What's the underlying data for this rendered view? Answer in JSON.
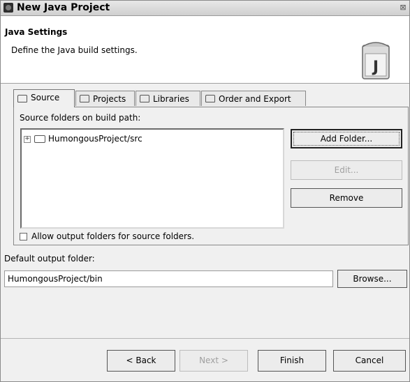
{
  "window": {
    "title": "New Java Project",
    "close_glyph": "⊠"
  },
  "banner": {
    "heading": "Java Settings",
    "description": "Define the Java build settings.",
    "icon_letter": "J"
  },
  "tabs": [
    {
      "label": "Source",
      "active": true,
      "icon": "source-folder-icon"
    },
    {
      "label": "Projects",
      "active": false,
      "icon": "projects-icon"
    },
    {
      "label": "Libraries",
      "active": false,
      "icon": "libraries-icon"
    },
    {
      "label": "Order and Export",
      "active": false,
      "icon": "order-export-icon"
    }
  ],
  "source_tab": {
    "folders_label": "Source folders on build path:",
    "tree_items": [
      {
        "label": "HumongousProject/src",
        "expander": "+"
      }
    ],
    "buttons": {
      "add_folder": "Add Folder...",
      "edit": "Edit...",
      "remove": "Remove"
    },
    "allow_output_label": "Allow output folders for source folders.",
    "allow_output_checked": false
  },
  "output": {
    "label": "Default output folder:",
    "value": "HumongousProject/bin",
    "browse": "Browse..."
  },
  "footer": {
    "back": "< Back",
    "next": "Next >",
    "finish": "Finish",
    "cancel": "Cancel"
  }
}
